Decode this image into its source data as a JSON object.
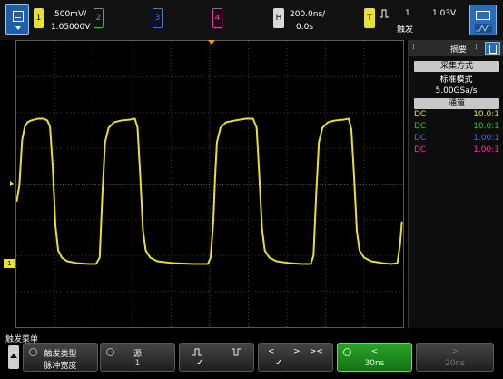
{
  "header": {
    "ch1": {
      "label": "1",
      "scale": "500mV/",
      "offset": "1.05000V"
    },
    "ch2": {
      "label": "2"
    },
    "ch3": {
      "label": "3"
    },
    "ch4": {
      "label": "4"
    },
    "horizontal": {
      "label": "H",
      "scale": "200.0ns/",
      "delay": "0.0s"
    },
    "trigger": {
      "label": "T",
      "source": "1",
      "level": "1.03V",
      "mode": "触发"
    }
  },
  "colors": {
    "ch1": "#e8e22a",
    "ch2": "#2ac82a",
    "ch3": "#4d6ee8",
    "ch4": "#e83aa0",
    "trigger": "#f29c1a",
    "active": "#28a428"
  },
  "markers": {
    "ch1": "1"
  },
  "sidebar": {
    "title": "摘要",
    "acq_button": "采集方式",
    "acq_mode": "标准模式",
    "sample_rate": "5.00GSa/s",
    "channels_button": "通道",
    "channels": [
      {
        "coupling": "DC",
        "probe": "10.0:1",
        "color": "#e8e22a"
      },
      {
        "coupling": "DC",
        "probe": "10.0:1",
        "color": "#2ac82a"
      },
      {
        "coupling": "DC",
        "probe": "1.00:1",
        "color": "#4d6ee8"
      },
      {
        "coupling": "DC",
        "probe": "1.00:1",
        "color": "#e83aa0"
      }
    ]
  },
  "softkeys": {
    "menu_title": "触发菜单",
    "trigger_type": {
      "label": "触发类型",
      "value": "脉冲宽度"
    },
    "source": {
      "label": "源",
      "value": "1"
    },
    "polarity": {
      "check": "✓"
    },
    "qualifier": {
      "left": "<",
      "mid": ">",
      "right": "><",
      "check": "✓"
    },
    "time_less": {
      "symbol": "<",
      "value": "30ns"
    },
    "time_greater": {
      "symbol": ">",
      "value": "20ns"
    }
  }
}
